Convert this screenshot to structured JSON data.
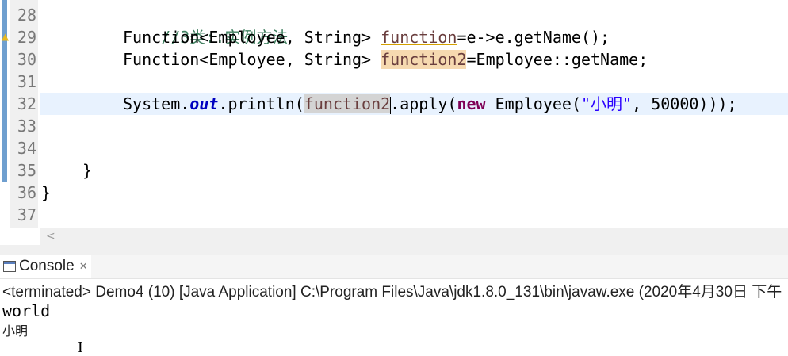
{
  "editor": {
    "line_numbers": [
      "28",
      "29",
      "30",
      "31",
      "32",
      "33",
      "34",
      "35",
      "36",
      "37"
    ],
    "lines": {
      "l28": {
        "comment": "//3类::实例方法"
      },
      "l29": {
        "t1": "Function<Employee, String> ",
        "var": "function",
        "t2": "=e->e.getName();"
      },
      "l30": {
        "t1": "Function<Employee, String> ",
        "var": "function2",
        "t2": "=Employee::getName;"
      },
      "l32": {
        "t1": "System.",
        "field": "out",
        "t2": ".println(",
        "var": "function2",
        "t3": ".apply(",
        "kw": "new",
        "t4": " Employee(",
        "str": "\"小明\"",
        "t5": ", 50000)));"
      },
      "l35": {
        "text": "}"
      },
      "l36": {
        "text": "}"
      }
    },
    "scroll_arrow": "<"
  },
  "console": {
    "tab_label": "Console",
    "tab_close": "✕",
    "status": "<terminated> Demo4 (10) [Java Application] C:\\Program Files\\Java\\jdk1.8.0_131\\bin\\javaw.exe (2020年4月30日 下午",
    "output": [
      "world",
      "小明"
    ],
    "cursor": "I"
  },
  "colors": {
    "comment": "#3f7f5f",
    "keyword": "#7f0055",
    "field": "#0000c0",
    "string": "#2a00ff",
    "occurrence_write": "#f6d9b0",
    "occurrence_read": "#d4d4d4",
    "current_line": "#e8f2fe"
  }
}
